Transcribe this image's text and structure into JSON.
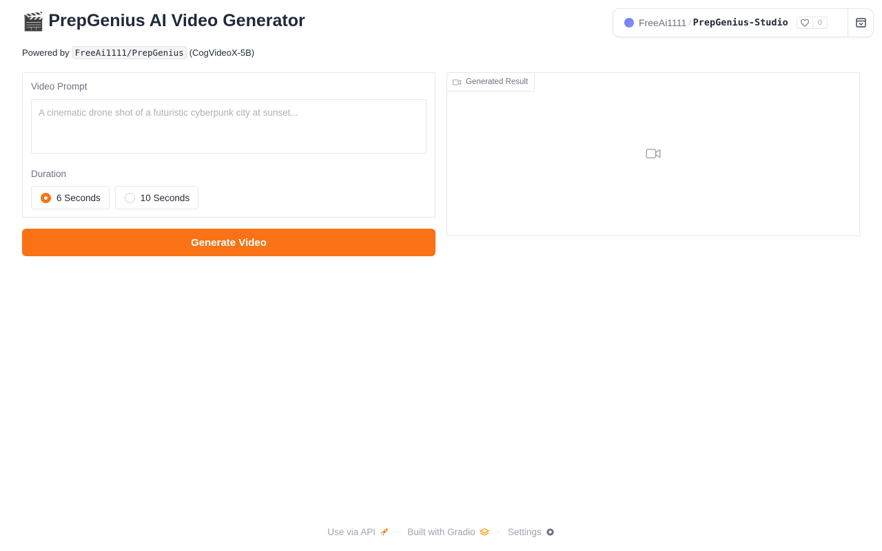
{
  "header": {
    "emoji": "🎬",
    "title": "PrepGenius AI Video Generator"
  },
  "powered": {
    "prefix": "Powered by",
    "repo": "FreeAi1111/PrepGenius",
    "suffix": "(CogVideoX-5B)"
  },
  "space_badge": {
    "owner": "FreeAi1111",
    "separator": "/",
    "repo": "PrepGenius-Studio",
    "likes": "0"
  },
  "form": {
    "prompt_label": "Video Prompt",
    "prompt_value": "",
    "prompt_placeholder": "A cinematic drone shot of a futuristic cyberpunk city at sunset...",
    "duration_label": "Duration",
    "duration_options": [
      {
        "label": "6 Seconds",
        "checked": true
      },
      {
        "label": "10 Seconds",
        "checked": false
      }
    ],
    "generate_label": "Generate Video"
  },
  "result": {
    "label": "Generated Result"
  },
  "footer": {
    "api_label": "Use via API",
    "built_label": "Built with Gradio",
    "settings_label": "Settings",
    "separator": "·"
  },
  "colors": {
    "accent": "#f97316",
    "border": "#e5e7eb",
    "muted_text": "#6b7280"
  },
  "icons": {
    "title": "clapperboard-emoji",
    "badge": "space-dot",
    "like": "heart-icon",
    "collapse": "collapse-icon",
    "result_tag": "video-camera-icon",
    "empty_video": "video-camera-icon",
    "api": "rocket-icon",
    "gradio": "gradio-logo-icon",
    "settings": "gear-icon"
  }
}
